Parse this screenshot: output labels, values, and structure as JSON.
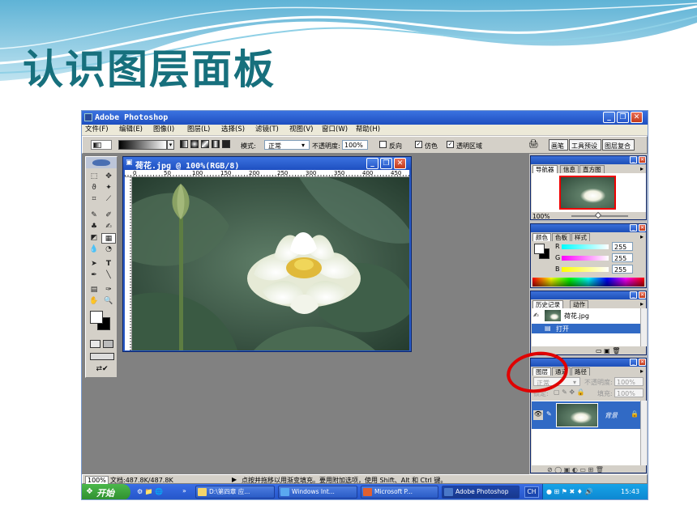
{
  "slide": {
    "title": "认识图层面板"
  },
  "window": {
    "title": "Adobe Photoshop",
    "minimize": "_",
    "restore": "❐",
    "close": "✕"
  },
  "menu": [
    "文件(F)",
    "编辑(E)",
    "图像(I)",
    "图层(L)",
    "选择(S)",
    "滤镜(T)",
    "视图(V)",
    "窗口(W)",
    "帮助(H)"
  ],
  "options": {
    "mode_label": "模式:",
    "mode_value": "正常",
    "opacity_label": "不透明度:",
    "opacity_value": "100%",
    "reverse_label": "反向",
    "dither_label": "仿色",
    "transparency_label": "透明区域",
    "dither_checked": true,
    "transparency_checked": true,
    "reverse_checked": false,
    "well_tabs": [
      "画笔",
      "工具预设",
      "图层复合"
    ]
  },
  "document": {
    "title": "荷花.jpg @ 100%(RGB/8)",
    "ruler_ticks": [
      "0",
      "50",
      "100",
      "150",
      "200",
      "250",
      "300",
      "350",
      "400",
      "450"
    ]
  },
  "navigator": {
    "tabs": [
      "导航器",
      "信息",
      "直方图"
    ],
    "zoom": "100%"
  },
  "color": {
    "tabs": [
      "颜色",
      "色板",
      "样式"
    ],
    "channels": [
      {
        "label": "R",
        "value": "255"
      },
      {
        "label": "G",
        "value": "255"
      },
      {
        "label": "B",
        "value": "255"
      }
    ]
  },
  "history": {
    "tabs": [
      "历史记录",
      "动作"
    ],
    "snapshot": "荷花.jpg",
    "items": [
      "打开"
    ]
  },
  "layers": {
    "tabs": [
      "图层",
      "通道",
      "路径"
    ],
    "blend_mode": "正常",
    "opacity_label": "不透明度:",
    "opacity_value": "100%",
    "lock_label": "锁定:",
    "fill_label": "填充:",
    "fill_value": "100%",
    "layer_name": "背景"
  },
  "status": {
    "zoom": "100%",
    "doc_size": "文档:487.8K/487.8K",
    "hint": "点按并拖移以用渐变填充。要用附加选项，使用 Shift、Alt 和 Ctrl 键。"
  },
  "taskbar": {
    "start": "开始",
    "overflow": "»",
    "items": [
      "D:\\第四章 应...",
      "Windows Int...",
      "Microsoft P...",
      "Adobe Photoshop"
    ],
    "lang": "CH",
    "clock": "15:43"
  },
  "colors": {
    "title": "#17707d",
    "highlight": "#e00000",
    "xp_blue": "#245edb"
  }
}
